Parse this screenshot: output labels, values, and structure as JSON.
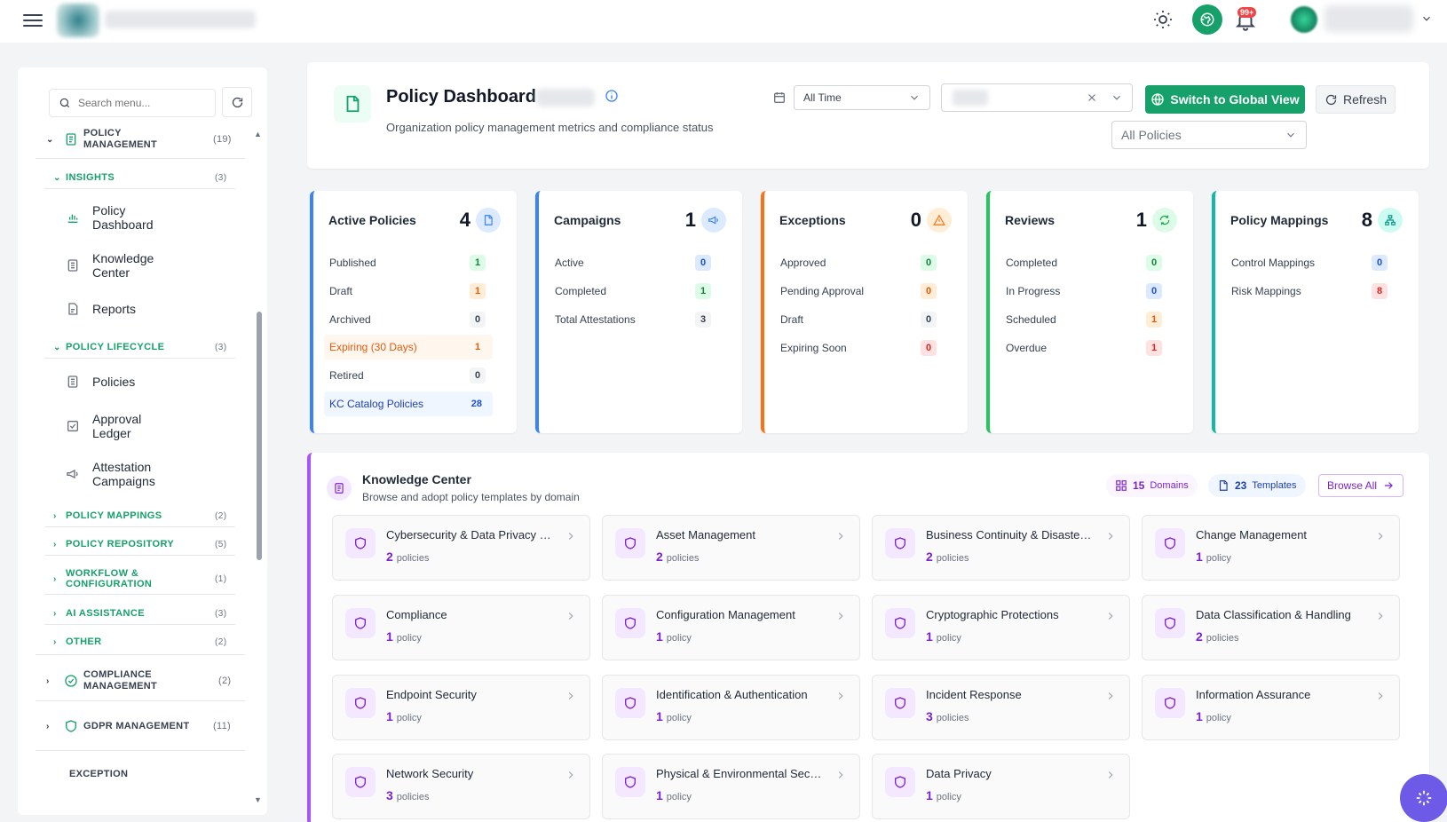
{
  "topbar": {
    "notification_count": "99+"
  },
  "sidebar": {
    "search_placeholder": "Search menu...",
    "sections": [
      {
        "label": "POLICY MANAGEMENT",
        "count": "(19)"
      },
      {
        "label": "COMPLIANCE MANAGEMENT",
        "count": "(2)"
      },
      {
        "label": "GDPR MANAGEMENT",
        "count": "(11)"
      },
      {
        "label": "EXCEPTION",
        "count": ""
      }
    ],
    "groups": [
      {
        "label": "INSIGHTS",
        "count": "(3)"
      },
      {
        "label": "POLICY LIFECYCLE",
        "count": "(3)"
      },
      {
        "label": "POLICY MAPPINGS",
        "count": "(2)"
      },
      {
        "label": "POLICY REPOSITORY",
        "count": "(5)"
      },
      {
        "label": "WORKFLOW & CONFIGURATION",
        "count": "(1)"
      },
      {
        "label": "AI ASSISTANCE",
        "count": "(3)"
      },
      {
        "label": "OTHER",
        "count": "(2)"
      }
    ],
    "items": [
      {
        "label": "Policy Dashboard",
        "icon": "bar-chart-icon"
      },
      {
        "label": "Knowledge Center",
        "icon": "document-icon"
      },
      {
        "label": "Reports",
        "icon": "file-report-icon"
      },
      {
        "label": "Policies",
        "icon": "list-icon"
      },
      {
        "label": "Approval Ledger",
        "icon": "checkbox-icon"
      },
      {
        "label": "Attestation Campaigns",
        "icon": "megaphone-icon"
      }
    ]
  },
  "header": {
    "title": "Policy Dashboard",
    "subtitle": "Organization policy management metrics and compliance status",
    "time_filter": "All Time",
    "policy_filter": "All Policies",
    "global_view_label": "Switch to Global View",
    "refresh_label": "Refresh"
  },
  "stats": [
    {
      "title": "Active Policies",
      "value": "4",
      "color": "#3b82f6",
      "rows": [
        {
          "label": "Published",
          "value": "1",
          "badge": "green"
        },
        {
          "label": "Draft",
          "value": "1",
          "badge": "orange"
        },
        {
          "label": "Archived",
          "value": "0",
          "badge": "gray"
        },
        {
          "label": "Expiring (30 Days)",
          "value": "1",
          "badge": "orange"
        },
        {
          "label": "Retired",
          "value": "0",
          "badge": "gray"
        },
        {
          "label": "KC Catalog Policies",
          "value": "28",
          "badge": "blue"
        }
      ]
    },
    {
      "title": "Campaigns",
      "value": "1",
      "color": "#3b82f6",
      "rows": [
        {
          "label": "Active",
          "value": "0",
          "badge": "blue"
        },
        {
          "label": "Completed",
          "value": "1",
          "badge": "green"
        },
        {
          "label": "Total Attestations",
          "value": "3",
          "badge": "gray"
        }
      ]
    },
    {
      "title": "Exceptions",
      "value": "0",
      "color": "#f97316",
      "rows": [
        {
          "label": "Approved",
          "value": "0",
          "badge": "green"
        },
        {
          "label": "Pending Approval",
          "value": "0",
          "badge": "orange"
        },
        {
          "label": "Draft",
          "value": "0",
          "badge": "gray"
        },
        {
          "label": "Expiring Soon",
          "value": "0",
          "badge": "red"
        }
      ]
    },
    {
      "title": "Reviews",
      "value": "1",
      "color": "#22c55e",
      "rows": [
        {
          "label": "Completed",
          "value": "0",
          "badge": "green"
        },
        {
          "label": "In Progress",
          "value": "0",
          "badge": "blue"
        },
        {
          "label": "Scheduled",
          "value": "1",
          "badge": "orange"
        },
        {
          "label": "Overdue",
          "value": "1",
          "badge": "red"
        }
      ]
    },
    {
      "title": "Policy Mappings",
      "value": "8",
      "color": "#14b8a6",
      "rows": [
        {
          "label": "Control Mappings",
          "value": "0",
          "badge": "blue"
        },
        {
          "label": "Risk Mappings",
          "value": "8",
          "badge": "red"
        }
      ]
    }
  ],
  "kc": {
    "title": "Knowledge Center",
    "subtitle": "Browse and adopt policy templates by domain",
    "domains_count": "15",
    "domains_label": "Domains",
    "templates_count": "23",
    "templates_label": "Templates",
    "browse_label": "Browse All",
    "tiles": [
      {
        "name": "Cybersecurity & Data Privacy Go...",
        "count": "2",
        "unit": "policies"
      },
      {
        "name": "Asset Management",
        "count": "2",
        "unit": "policies"
      },
      {
        "name": "Business Continuity & Disaster R...",
        "count": "2",
        "unit": "policies"
      },
      {
        "name": "Change Management",
        "count": "1",
        "unit": "policy"
      },
      {
        "name": "Compliance",
        "count": "1",
        "unit": "policy"
      },
      {
        "name": "Configuration Management",
        "count": "1",
        "unit": "policy"
      },
      {
        "name": "Cryptographic Protections",
        "count": "1",
        "unit": "policy"
      },
      {
        "name": "Data Classification & Handling",
        "count": "2",
        "unit": "policies"
      },
      {
        "name": "Endpoint Security",
        "count": "1",
        "unit": "policy"
      },
      {
        "name": "Identification & Authentication",
        "count": "1",
        "unit": "policy"
      },
      {
        "name": "Incident Response",
        "count": "3",
        "unit": "policies"
      },
      {
        "name": "Information Assurance",
        "count": "1",
        "unit": "policy"
      },
      {
        "name": "Network Security",
        "count": "3",
        "unit": "policies"
      },
      {
        "name": "Physical & Environmental Security",
        "count": "1",
        "unit": "policy"
      },
      {
        "name": "Data Privacy",
        "count": "1",
        "unit": "policy"
      }
    ]
  }
}
